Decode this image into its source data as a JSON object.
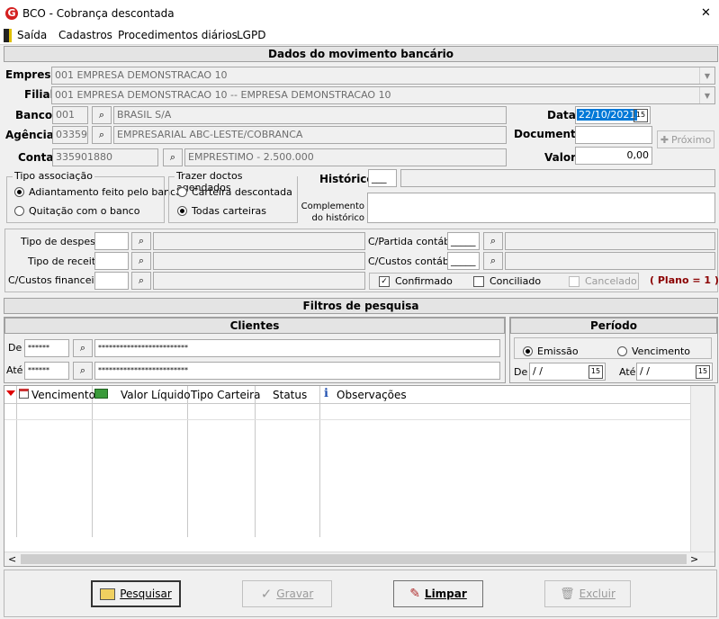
{
  "window": {
    "title": "BCO - Cobrança descontada",
    "close": "✕"
  },
  "menu": [
    "Saída",
    "Cadastros",
    "Procedimentos diários",
    "LGPD"
  ],
  "sections": {
    "movimento": "Dados do movimento bancário",
    "filtros": "Filtros de pesquisa"
  },
  "form": {
    "empresa_label": "Empresa",
    "empresa_value": "001 EMPRESA DEMONSTRACAO 10",
    "filial_label": "Filial",
    "filial_value": "001 EMPRESA DEMONSTRACAO 10 -- EMPRESA DEMONSTRACAO 10",
    "banco_label": "Banco",
    "banco_code": "001",
    "banco_name": "BRASIL S/A",
    "agencia_label": "Agência",
    "agencia_code": "03359",
    "agencia_name": "EMPRESARIAL ABC-LESTE/COBRANCA",
    "conta_label": "Conta",
    "conta_code": "335901880",
    "conta_name": "EMPRESTIMO - 2.500.000",
    "data_label": "Data",
    "data_value": "22/10/2021",
    "documento_label": "Documento",
    "documento_value": "",
    "proximo_label": "Próximo",
    "valor_label": "Valor",
    "valor_value": "0,00",
    "historico_label": "Histórico",
    "historico_code": "___",
    "complemento_label": "Complemento do histórico",
    "tipo_assoc_title": "Tipo associação",
    "tipo_assoc_options": [
      "Adiantamento feito pelo banco",
      "Quitação com o banco"
    ],
    "trazer_title": "Trazer doctos agendados",
    "trazer_options": [
      "Carteira descontada",
      "Todas carteiras"
    ],
    "tipo_despesa_label": "Tipo de despesa",
    "tipo_receita_label": "Tipo de receita",
    "cc_financeiro_label": "C/Custos financeiro",
    "cpartida_label": "C/Partida contábil",
    "cpartida_code": "_____",
    "ccustos_label": "C/Custos contábil",
    "ccustos_code": "_____",
    "confirmado_label": "Confirmado",
    "conciliado_label": "Conciliado",
    "cancelado_label": "Cancelado",
    "plano_label": "( Plano = 1 )"
  },
  "filtros": {
    "clientes_title": "Clientes",
    "de_label": "De",
    "ate_label": "Até",
    "de_code": "******",
    "de_name": "*************************",
    "ate_code": "******",
    "ate_name": "*************************",
    "periodo_title": "Período",
    "emissao_label": "Emissão",
    "vencimento_label": "Vencimento",
    "periodo_de_label": "De",
    "periodo_ate_label": "Até",
    "periodo_de_value": " /  /",
    "periodo_ate_value": " /  /"
  },
  "grid": {
    "columns": [
      "Vencimento",
      "Valor Líquido",
      "Tipo Carteira",
      "Status",
      "Observações"
    ]
  },
  "buttons": {
    "pesquisar": "Pesquisar",
    "gravar": "Gravar",
    "limpar": "Limpar",
    "excluir": "Excluir"
  },
  "colors": {
    "plano": "#8b0000",
    "data_highlight": "#0078d7",
    "logo": "#d42020"
  }
}
